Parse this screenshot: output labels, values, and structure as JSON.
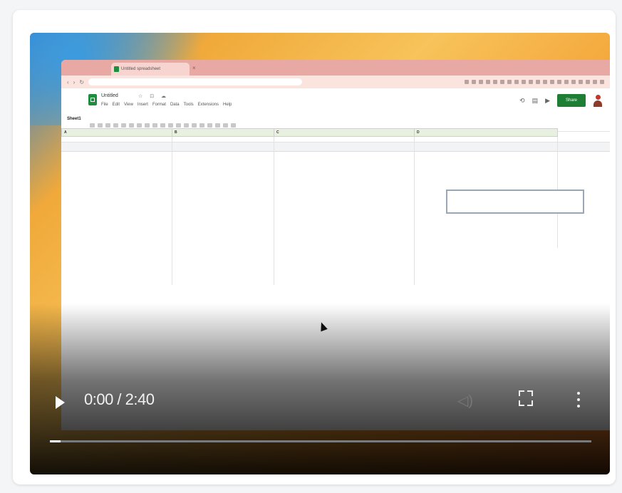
{
  "browser": {
    "tab_title": "Untitled spreadsheet",
    "tab_close": "×"
  },
  "sheets": {
    "doc_title": "Untitled",
    "title_icons": "☆ ⊡ ☁",
    "menu": [
      "File",
      "Edit",
      "View",
      "Insert",
      "Format",
      "Data",
      "Tools",
      "Extensions",
      "Help"
    ],
    "share_label": "Share",
    "sheet_title": "Sheet1",
    "headers": [
      "A",
      "B",
      "C",
      "D"
    ],
    "rows": [
      [
        "",
        "",
        "",
        ""
      ],
      [
        "",
        "",
        "",
        ""
      ],
      [
        "",
        "",
        "",
        ""
      ]
    ]
  },
  "player": {
    "time_display": "0:00 / 2:40",
    "progress": 0.02
  },
  "colors": {
    "sheets_green": "#1e8e3e",
    "share_green": "#1e7e34",
    "link_blue": "#3b5bb5"
  },
  "icons": [
    "sheets-logo-icon",
    "play-icon",
    "volume-icon",
    "fullscreen-icon",
    "more-vert-icon",
    "mouse-cursor-icon",
    "avatar-icon"
  ]
}
